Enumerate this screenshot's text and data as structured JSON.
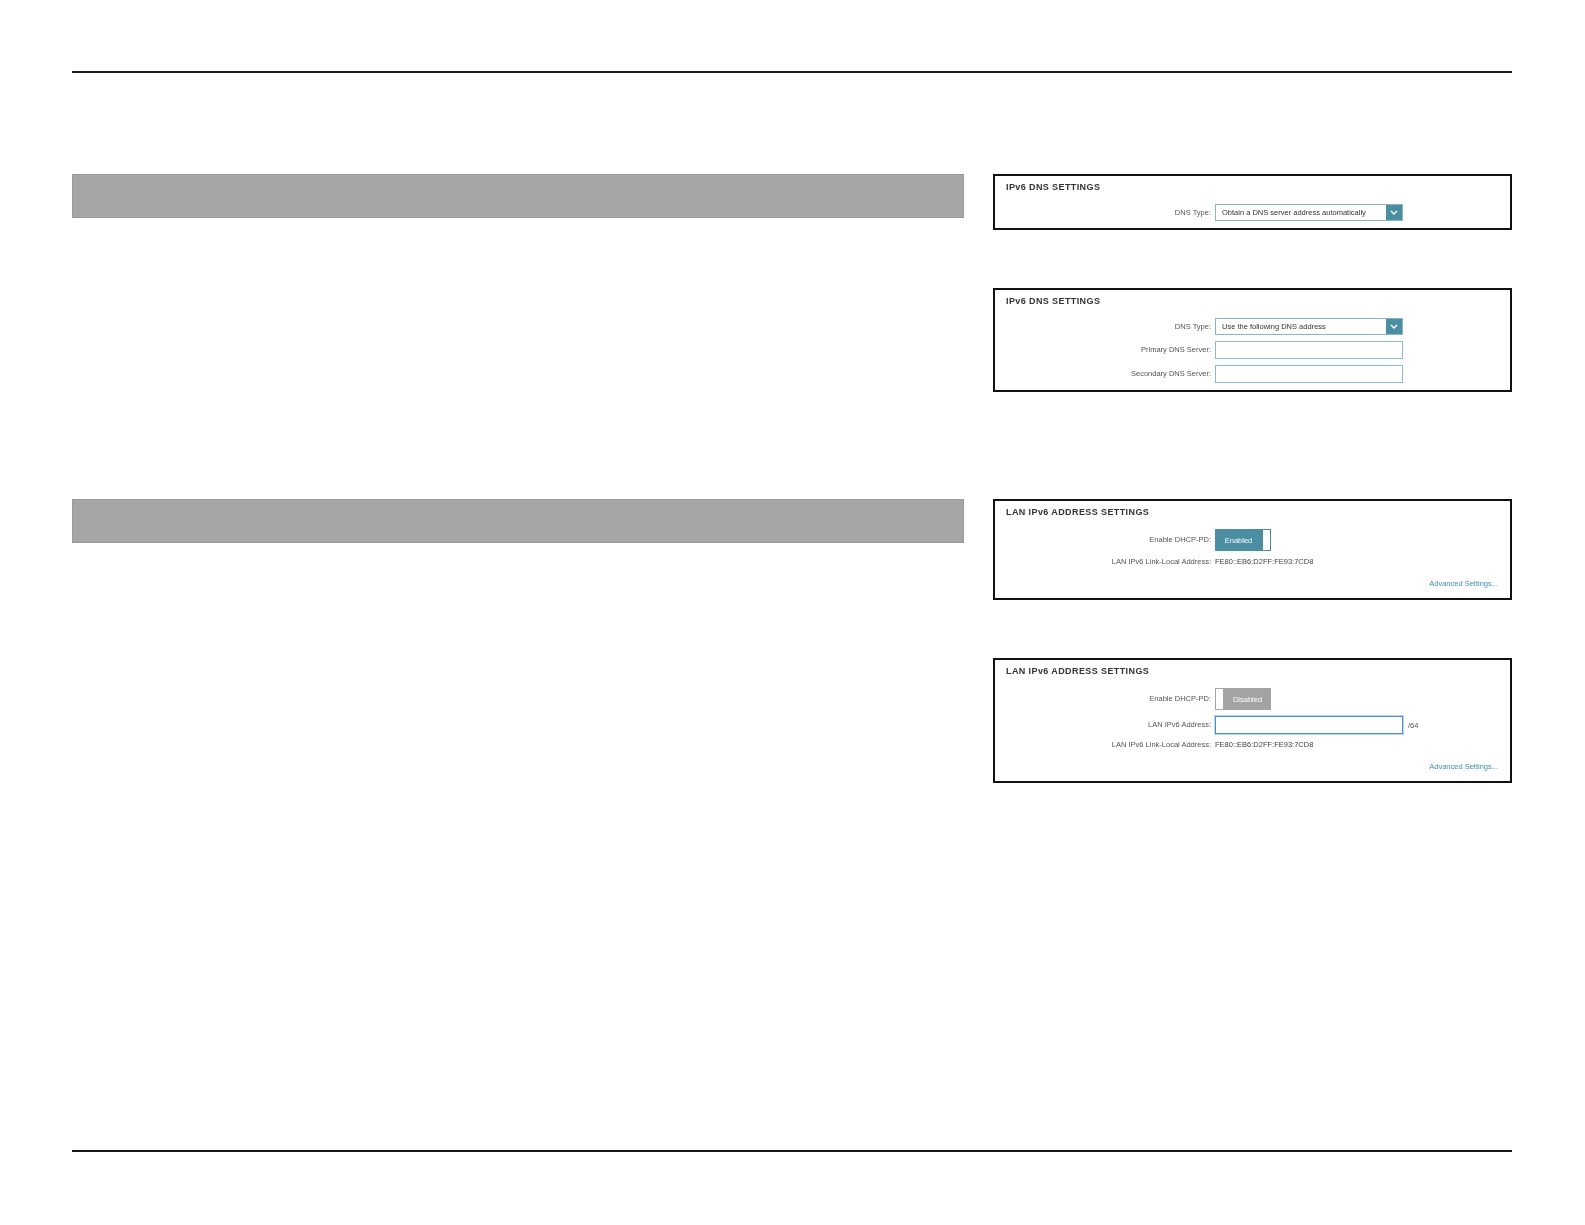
{
  "sections": [
    {
      "panels": [
        {
          "title": "IPv6 DNS SETTINGS",
          "rows": [
            {
              "kind": "select",
              "label": "DNS Type:",
              "value": "Obtain a DNS server address automatically"
            }
          ]
        },
        {
          "title": "IPv6 DNS SETTINGS",
          "rows": [
            {
              "kind": "select",
              "label": "DNS Type:",
              "value": "Use the following DNS address"
            },
            {
              "kind": "input",
              "label": "Primary DNS Server:",
              "focused": false
            },
            {
              "kind": "input",
              "label": "Secondary DNS Server:",
              "focused": false
            }
          ]
        }
      ]
    },
    {
      "panels": [
        {
          "title": "LAN IPv6 ADDRESS SETTINGS",
          "rows": [
            {
              "kind": "toggle",
              "label": "Enable DHCP-PD:",
              "text": "Enabled",
              "on": true
            },
            {
              "kind": "text",
              "label": "LAN IPv6 Link-Local Address:",
              "value": "FE80::EB6:D2FF:FE93:7CD8"
            }
          ],
          "link": "Advanced Settings..."
        },
        {
          "title": "LAN IPv6 ADDRESS SETTINGS",
          "rows": [
            {
              "kind": "toggle",
              "label": "Enable DHCP-PD:",
              "text": "Disabled",
              "on": false
            },
            {
              "kind": "input",
              "label": "LAN IPv6 Address:",
              "focused": true,
              "suffix": "/64"
            },
            {
              "kind": "text",
              "label": "LAN IPv6 Link-Local Address:",
              "value": "FE80::EB6:D2FF:FE93:7CD8"
            }
          ],
          "link": "Advanced Settings..."
        }
      ]
    }
  ]
}
